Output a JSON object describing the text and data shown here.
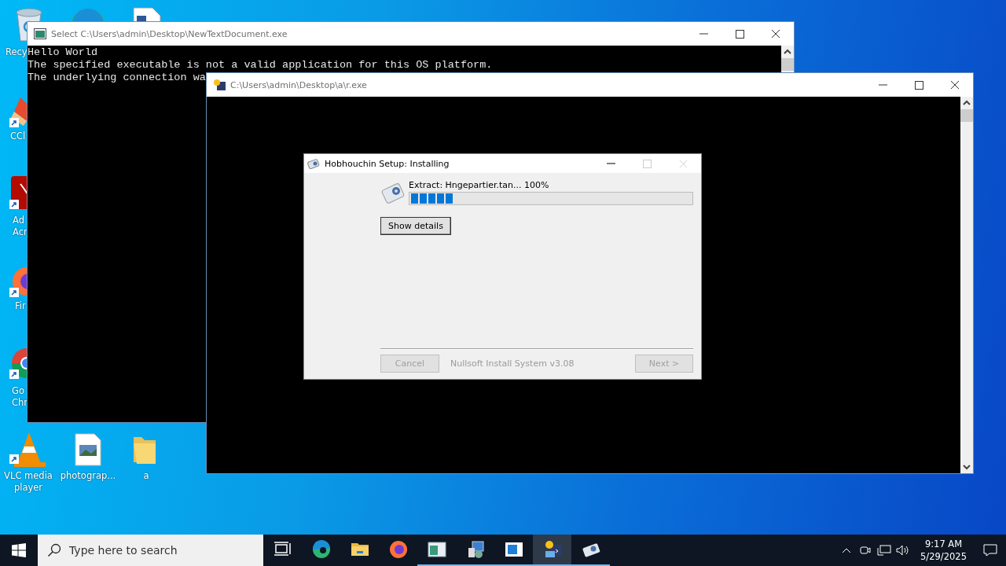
{
  "desktop": {
    "icons": [
      {
        "label": "Recy",
        "selected": false
      },
      {
        "selected": false
      },
      {
        "selected": false
      },
      {
        "label": "CCl",
        "selected": false
      },
      {
        "label": "Ad\nAcr",
        "selected": false
      },
      {
        "label": "Fir",
        "selected": false
      },
      {
        "label": "Go\nChr",
        "selected": false
      },
      {
        "label": "VLC media player",
        "selected": false
      },
      {
        "label": "photograp...",
        "selected": false
      },
      {
        "label": "a",
        "selected": false
      }
    ]
  },
  "windows": [
    {
      "title": "Select C:\\Users\\admin\\Desktop\\NewTextDocument.exe",
      "lines": [
        "Hello World",
        "The specified executable is not a valid application for this OS platform.",
        "The underlying connection wa"
      ]
    },
    {
      "title": "C:\\Users\\admin\\Desktop\\a\\r.exe"
    }
  ],
  "installer": {
    "title": "Hobhouchin Setup: Installing",
    "status": "Extract: Hngepartier.tan... 100%",
    "progress": {
      "level": 0.15
    },
    "details_button": {
      "label": "Show details",
      "disabled": false
    },
    "footer": {
      "cancel": {
        "label": "Cancel",
        "disabled": true
      },
      "branding": "Nullsoft Install System v3.08",
      "next": {
        "label": "Next >",
        "disabled": true
      }
    }
  },
  "taskbar": {
    "search": {
      "placeholder": "Type here to search"
    },
    "apps": [
      {
        "running": false,
        "selected": false
      },
      {
        "running": false,
        "selected": false
      },
      {
        "running": false,
        "selected": false
      },
      {
        "running": false,
        "selected": false
      },
      {
        "running": true,
        "selected": false
      },
      {
        "running": true,
        "selected": false
      },
      {
        "running": true,
        "selected": false
      },
      {
        "running": true,
        "selected": true
      },
      {
        "running": true,
        "selected": false
      }
    ],
    "clock": {
      "time": "9:17 AM",
      "date": "5/29/2025"
    }
  }
}
